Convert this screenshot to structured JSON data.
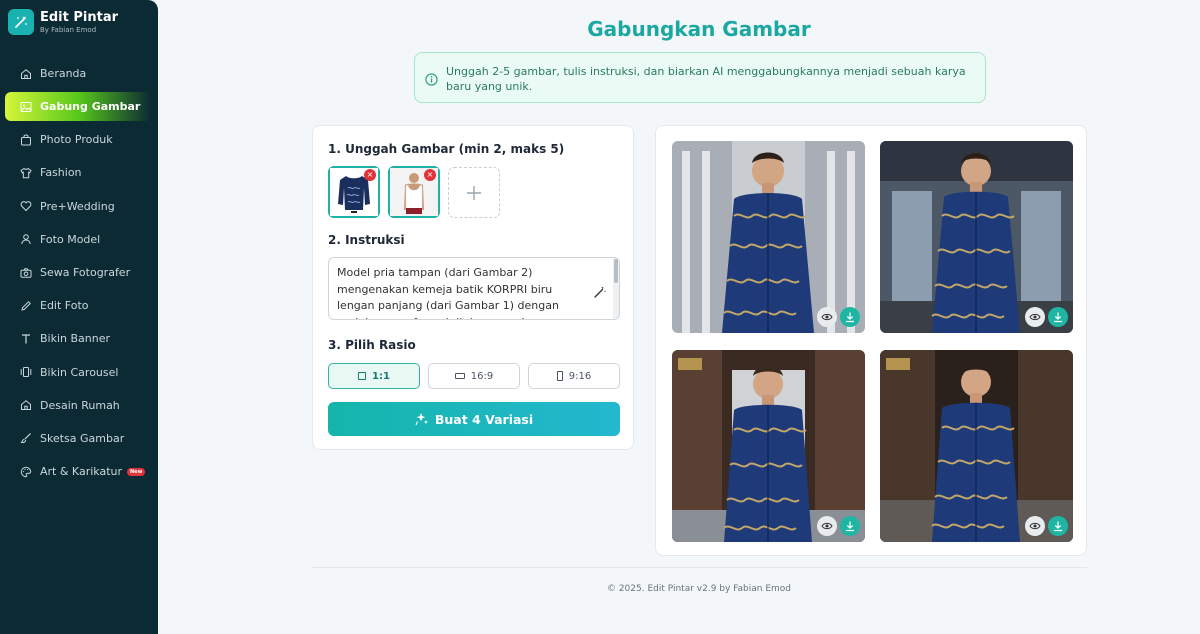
{
  "brand": {
    "title": "Edit Pintar",
    "subtitle": "By Fabian Emod"
  },
  "sidebar": {
    "items": [
      {
        "label": "Beranda",
        "icon": "home-icon"
      },
      {
        "label": "Gabung Gambar",
        "icon": "image-icon",
        "active": true
      },
      {
        "label": "Photo Produk",
        "icon": "bag-icon"
      },
      {
        "label": "Fashion",
        "icon": "shirt-icon"
      },
      {
        "label": "Pre+Wedding",
        "icon": "heart-icon"
      },
      {
        "label": "Foto Model",
        "icon": "user-icon"
      },
      {
        "label": "Sewa Fotografer",
        "icon": "camera-icon"
      },
      {
        "label": "Edit Foto",
        "icon": "pencil-icon"
      },
      {
        "label": "Bikin Banner",
        "icon": "text-icon"
      },
      {
        "label": "Bikin Carousel",
        "icon": "carousel-icon"
      },
      {
        "label": "Desain Rumah",
        "icon": "house-icon"
      },
      {
        "label": "Sketsa Gambar",
        "icon": "brush-icon"
      },
      {
        "label": "Art & Karikatur",
        "icon": "palette-icon",
        "badge": "New"
      }
    ]
  },
  "main": {
    "title": "Gabungkan Gambar",
    "info": "Unggah 2-5 gambar, tulis instruksi, dan biarkan AI menggabungkannya menjadi sebuah karya baru yang unik.",
    "upload": {
      "title": "1. Unggah Gambar (min 2, maks 5)",
      "remove_glyph": "×",
      "thumbnails": [
        "batik-shirt",
        "white-tank-top"
      ]
    },
    "instruction": {
      "title": "2. Instruksi",
      "value": "Model pria tampan (dari Gambar 2) mengenakan kemeja batik KORPRI biru lengan panjang (dari Gambar 1) dengan rapi, berpose formal di depan gedung"
    },
    "ratio": {
      "title": "3. Pilih Rasio",
      "options": [
        {
          "label": "1:1",
          "selected": true
        },
        {
          "label": "16:9",
          "selected": false
        },
        {
          "label": "9:16",
          "selected": false
        }
      ]
    },
    "generate_label": "Buat 4 Variasi",
    "results_count": 4
  },
  "footer": "© 2025. Edit Pintar v2.9 by Fabian Emod",
  "colors": {
    "accent": "#1ba7a2",
    "sidebar_bg": "#0c2a33",
    "active_green": "#7ad12a",
    "danger": "#e0333a"
  }
}
